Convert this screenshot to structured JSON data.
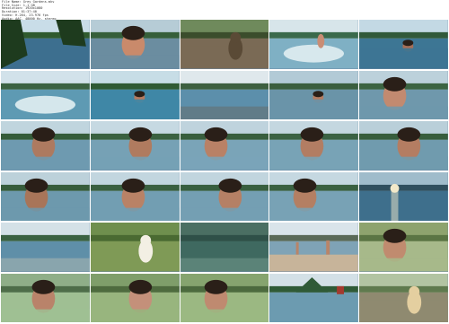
{
  "header": {
    "line1": "File Name: Grey Gardens.mkv",
    "line2": "File Size: 1.1 GB",
    "line3": "Resolution: 1920x1080",
    "line4": "Duration: 01:37:40",
    "line5": "Video: H.264, 23.976 fps",
    "line6": "Audio: AAC, 48000 Hz, stereo"
  },
  "thumbnails": [
    {
      "scene": "lakeshore-trees"
    },
    {
      "scene": "man-swimming-closeup"
    },
    {
      "scene": "dog-on-rocks"
    },
    {
      "scene": "woman-splashing"
    },
    {
      "scene": "woman-swimming"
    },
    {
      "scene": "lake-wide-splash"
    },
    {
      "scene": "swimmer-in-lake"
    },
    {
      "scene": "calm-lake-dock"
    },
    {
      "scene": "man-underwater-eyes"
    },
    {
      "scene": "couple-closeup"
    },
    {
      "scene": "woman-face-water"
    },
    {
      "scene": "man-face-water"
    },
    {
      "scene": "man-turning"
    },
    {
      "scene": "man-smiling-water"
    },
    {
      "scene": "man-and-woman-water"
    },
    {
      "scene": "woman-closeup-water"
    },
    {
      "scene": "woman-laughing"
    },
    {
      "scene": "man-swimming-smile"
    },
    {
      "scene": "man-face-lake"
    },
    {
      "scene": "sunlit-water"
    },
    {
      "scene": "lake-horizon-swimmer"
    },
    {
      "scene": "dog-portrait"
    },
    {
      "scene": "dark-water-swimmer"
    },
    {
      "scene": "couple-on-beach"
    },
    {
      "scene": "woman-smiling-closeup"
    },
    {
      "scene": "couple-talking"
    },
    {
      "scene": "woman-shore-portrait"
    },
    {
      "scene": "couple-on-dock"
    },
    {
      "scene": "island-red-boathouse"
    },
    {
      "scene": "dog-on-dock"
    }
  ]
}
